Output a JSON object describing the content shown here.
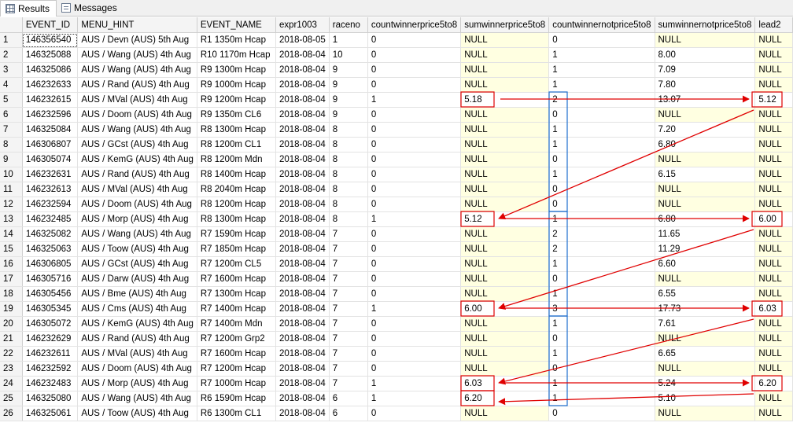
{
  "tabs": [
    {
      "label": "Results",
      "icon": "grid-icon"
    },
    {
      "label": "Messages",
      "icon": "messages-icon"
    }
  ],
  "columns": [
    "",
    "EVENT_ID",
    "MENU_HINT",
    "EVENT_NAME",
    "expr1003",
    "raceno",
    "countwinnerprice5to8",
    "sumwinnerprice5to8",
    "countwinnernotprice5to8",
    "sumwinnernotprice5to8",
    "lead2"
  ],
  "rows": [
    [
      "1",
      "146356540",
      "AUS / Devn (AUS) 5th Aug",
      "R1 1350m Hcap",
      "2018-08-05",
      "1",
      "0",
      "NULL",
      "0",
      "NULL",
      "NULL"
    ],
    [
      "2",
      "146325088",
      "AUS / Wang (AUS) 4th Aug",
      "R10 1170m Hcap",
      "2018-08-04",
      "10",
      "0",
      "NULL",
      "1",
      "8.00",
      "NULL"
    ],
    [
      "3",
      "146325086",
      "AUS / Wang (AUS) 4th Aug",
      "R9 1300m Hcap",
      "2018-08-04",
      "9",
      "0",
      "NULL",
      "1",
      "7.09",
      "NULL"
    ],
    [
      "4",
      "146232633",
      "AUS / Rand (AUS) 4th Aug",
      "R9 1000m Hcap",
      "2018-08-04",
      "9",
      "0",
      "NULL",
      "1",
      "7.80",
      "NULL"
    ],
    [
      "5",
      "146232615",
      "AUS / MVal (AUS) 4th Aug",
      "R9 1200m Hcap",
      "2018-08-04",
      "9",
      "1",
      "5.18",
      "2",
      "13.07",
      "5.12"
    ],
    [
      "6",
      "146232596",
      "AUS / Doom (AUS) 4th Aug",
      "R9 1350m CL6",
      "2018-08-04",
      "9",
      "0",
      "NULL",
      "0",
      "NULL",
      "NULL"
    ],
    [
      "7",
      "146325084",
      "AUS / Wang (AUS) 4th Aug",
      "R8 1300m Hcap",
      "2018-08-04",
      "8",
      "0",
      "NULL",
      "1",
      "7.20",
      "NULL"
    ],
    [
      "8",
      "146306807",
      "AUS / GCst (AUS) 4th Aug",
      "R8 1200m CL1",
      "2018-08-04",
      "8",
      "0",
      "NULL",
      "1",
      "6.80",
      "NULL"
    ],
    [
      "9",
      "146305074",
      "AUS / KemG (AUS) 4th Aug",
      "R8 1200m Mdn",
      "2018-08-04",
      "8",
      "0",
      "NULL",
      "0",
      "NULL",
      "NULL"
    ],
    [
      "10",
      "146232631",
      "AUS / Rand (AUS) 4th Aug",
      "R8 1400m Hcap",
      "2018-08-04",
      "8",
      "0",
      "NULL",
      "1",
      "6.15",
      "NULL"
    ],
    [
      "11",
      "146232613",
      "AUS / MVal (AUS) 4th Aug",
      "R8 2040m Hcap",
      "2018-08-04",
      "8",
      "0",
      "NULL",
      "0",
      "NULL",
      "NULL"
    ],
    [
      "12",
      "146232594",
      "AUS / Doom (AUS) 4th Aug",
      "R8 1200m Hcap",
      "2018-08-04",
      "8",
      "0",
      "NULL",
      "0",
      "NULL",
      "NULL"
    ],
    [
      "13",
      "146232485",
      "AUS / Morp (AUS) 4th Aug",
      "R8 1300m Hcap",
      "2018-08-04",
      "8",
      "1",
      "5.12",
      "1",
      "6.80",
      "6.00"
    ],
    [
      "14",
      "146325082",
      "AUS / Wang (AUS) 4th Aug",
      "R7 1590m Hcap",
      "2018-08-04",
      "7",
      "0",
      "NULL",
      "2",
      "11.65",
      "NULL"
    ],
    [
      "15",
      "146325063",
      "AUS / Toow (AUS) 4th Aug",
      "R7 1850m Hcap",
      "2018-08-04",
      "7",
      "0",
      "NULL",
      "2",
      "11.29",
      "NULL"
    ],
    [
      "16",
      "146306805",
      "AUS / GCst (AUS) 4th Aug",
      "R7 1200m CL5",
      "2018-08-04",
      "7",
      "0",
      "NULL",
      "1",
      "6.60",
      "NULL"
    ],
    [
      "17",
      "146305716",
      "AUS / Darw (AUS) 4th Aug",
      "R7 1600m Hcap",
      "2018-08-04",
      "7",
      "0",
      "NULL",
      "0",
      "NULL",
      "NULL"
    ],
    [
      "18",
      "146305456",
      "AUS / Bme (AUS) 4th Aug",
      "R7 1300m Hcap",
      "2018-08-04",
      "7",
      "0",
      "NULL",
      "1",
      "6.55",
      "NULL"
    ],
    [
      "19",
      "146305345",
      "AUS / Cms (AUS) 4th Aug",
      "R7 1400m Hcap",
      "2018-08-04",
      "7",
      "1",
      "6.00",
      "3",
      "17.73",
      "6.03"
    ],
    [
      "20",
      "146305072",
      "AUS / KemG (AUS) 4th Aug",
      "R7 1400m Mdn",
      "2018-08-04",
      "7",
      "0",
      "NULL",
      "1",
      "7.61",
      "NULL"
    ],
    [
      "21",
      "146232629",
      "AUS / Rand (AUS) 4th Aug",
      "R7 1200m Grp2",
      "2018-08-04",
      "7",
      "0",
      "NULL",
      "0",
      "NULL",
      "NULL"
    ],
    [
      "22",
      "146232611",
      "AUS / MVal (AUS) 4th Aug",
      "R7 1600m Hcap",
      "2018-08-04",
      "7",
      "0",
      "NULL",
      "1",
      "6.65",
      "NULL"
    ],
    [
      "23",
      "146232592",
      "AUS / Doom (AUS) 4th Aug",
      "R7 1200m Hcap",
      "2018-08-04",
      "7",
      "0",
      "NULL",
      "0",
      "NULL",
      "NULL"
    ],
    [
      "24",
      "146232483",
      "AUS / Morp (AUS) 4th Aug",
      "R7 1000m Hcap",
      "2018-08-04",
      "7",
      "1",
      "6.03",
      "1",
      "5.24",
      "6.20"
    ],
    [
      "25",
      "146325080",
      "AUS / Wang (AUS) 4th Aug",
      "R6 1590m Hcap",
      "2018-08-04",
      "6",
      "1",
      "6.20",
      "1",
      "5.10",
      "NULL"
    ],
    [
      "26",
      "146325061",
      "AUS / Toow (AUS) 4th Aug",
      "R6 1300m CL1",
      "2018-08-04",
      "6",
      "0",
      "NULL",
      "0",
      "NULL",
      "NULL"
    ]
  ],
  "colors": {
    "annotation_red": "#e00000",
    "annotation_blue": "#1f6fcf",
    "null_background": "#ffffe1"
  }
}
